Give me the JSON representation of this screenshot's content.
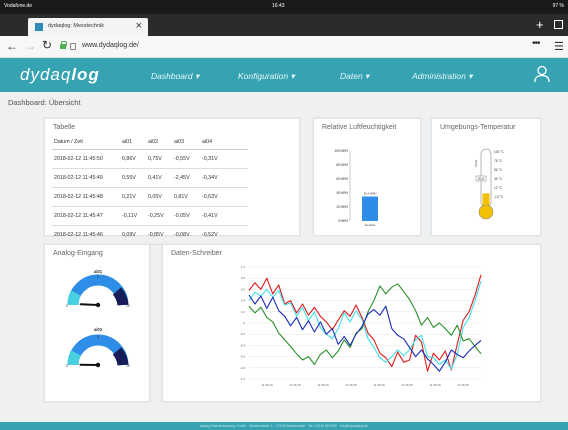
{
  "statusbar": {
    "carrier": "Vodafone.de",
    "time": "16:43",
    "battery": "97 %"
  },
  "browser": {
    "tab_title": "dydaqlog: Messtechnik",
    "url": "www.dydaqlog.de/",
    "more": "•••",
    "menu": "☰"
  },
  "nav": {
    "logo_light": "dydaq",
    "logo_bold": "log",
    "items": [
      {
        "label": "Dashboard ▾"
      },
      {
        "label": "Konfiguration ▾"
      },
      {
        "label": "Daten ▾"
      },
      {
        "label": "Administration ▾"
      }
    ]
  },
  "page": {
    "title": "Dashboard: Übersicht"
  },
  "tabelle": {
    "title": "Tabelle",
    "columns": [
      "Datum / Zeit",
      "ai01",
      "ai02",
      "ai03",
      "ai04"
    ],
    "rows": [
      [
        "2018-02-12  11:45:50",
        "0,86V",
        "0,75V",
        "-0,55V",
        "-0,31V"
      ],
      [
        "2018-02-12  11:45:49",
        "0,55V",
        "0,41V",
        "-2,45V",
        "-0,34V"
      ],
      [
        "2018-02-12  11:45:48",
        "0,21V",
        "0,05V",
        "0,81V",
        "-0,63V"
      ],
      [
        "2018-02-12  11:45:47",
        "-0,11V",
        "-0,25V",
        "-0,05V",
        "-0,41V"
      ],
      [
        "2018-02-12  11:45:46",
        "0,09V",
        "-0,85V",
        "-0,08V",
        "-0,52V"
      ]
    ]
  },
  "humidity": {
    "title": "Relative Luftfeuchtigkeit",
    "ticks": [
      "100%RH",
      "80%RH",
      "60%RH",
      "40%RH",
      "20%RH",
      "0%RH"
    ],
    "value": 35,
    "bar_label": "Feuchte",
    "value_text": "35,4 %RH",
    "color": "#2e8de6"
  },
  "temperature": {
    "title": "Umgebungs-Temperatur",
    "ticks": [
      "100 °C",
      "78 °C",
      "56 °C",
      "34 °C",
      "12 °C",
      "-10 °C"
    ],
    "value_text": "20,0",
    "label": "Temp",
    "level": 0.35,
    "color": "#f2c200"
  },
  "analog": {
    "title": "Analog-Eingang",
    "gauges": [
      {
        "label": "ai01",
        "value": 0.86,
        "min": "0",
        "max": "10",
        "mid": "5",
        "value_text": "0,86V"
      },
      {
        "label": "ai02",
        "value": 0.75,
        "min": "0",
        "max": "10",
        "mid": "5",
        "value_text": "0,75V"
      }
    ]
  },
  "recorder": {
    "title": "Daten-Schreiber",
    "colors": {
      "ai01": "#e01818",
      "ai02": "#3fe0e8",
      "ai03": "#2a8f2a",
      "ai04": "#1a2cb8"
    }
  },
  "footer": {
    "text": "dydaq Datenerfassung GmbH · Musterstraße 1 · 12345 Musterstadt · Tel. 01234 567890 · info@dydaqlog.de"
  },
  "chart_data": {
    "type": "line",
    "title": "Daten-Schreiber",
    "xlabel": "",
    "ylabel": "",
    "ylim": [
      -1,
      1
    ],
    "yticks": [
      "1.0",
      "0.8",
      "0.6",
      "0.4",
      "0.2",
      "0",
      "-0.2",
      "-0.4",
      "-0.6",
      "-0.8",
      "-1.0"
    ],
    "x": [
      "11:45:10",
      "11:45:15",
      "11:45:20",
      "11:45:25",
      "11:45:30",
      "11:45:35",
      "11:45:40",
      "11:45:45"
    ],
    "series": [
      {
        "name": "ai01",
        "values": [
          0.58,
          0.72,
          0.6,
          0.8,
          0.52,
          0.68,
          0.34,
          0.4,
          0.18,
          0.34,
          0.14,
          0.28,
          0.12,
          0.02,
          -0.12,
          0.05,
          0.22,
          0.12,
          0.32,
          0.1,
          -0.18,
          -0.3,
          -0.54,
          -0.62,
          -0.78,
          -0.52,
          -0.7,
          -0.66,
          -0.22,
          -0.34,
          -0.86,
          -0.54,
          -0.66,
          -0.5,
          -0.84,
          -0.38,
          0.05,
          0.2,
          0.5,
          0.86
        ]
      },
      {
        "name": "ai02",
        "values": [
          0.4,
          0.55,
          0.48,
          0.6,
          0.46,
          0.58,
          0.32,
          0.36,
          0.12,
          0.28,
          0.04,
          0.2,
          -0.08,
          -0.2,
          -0.28,
          -0.1,
          0.18,
          0.02,
          0.22,
          0.06,
          -0.28,
          -0.44,
          -0.62,
          -0.7,
          -0.6,
          -0.48,
          -0.58,
          -0.48,
          -0.3,
          -0.22,
          -0.6,
          -0.62,
          -0.74,
          -0.66,
          -0.82,
          -0.56,
          -0.08,
          0.1,
          0.4,
          0.75
        ]
      },
      {
        "name": "ai03",
        "values": [
          0.3,
          0.18,
          0.28,
          0.1,
          0.02,
          -0.18,
          -0.3,
          -0.42,
          -0.55,
          -0.66,
          -0.6,
          -0.74,
          -0.56,
          -0.48,
          -0.62,
          -0.5,
          -0.3,
          -0.44,
          -0.18,
          -0.1,
          0.2,
          0.4,
          0.66,
          0.52,
          0.64,
          0.7,
          0.56,
          0.42,
          0.22,
          -0.04,
          0.1,
          -0.08,
          0.0,
          -0.1,
          -0.22,
          -0.04,
          -0.32,
          -0.28,
          -0.42,
          -0.55
        ]
      },
      {
        "name": "ai04",
        "values": [
          0.5,
          0.34,
          0.48,
          0.26,
          0.46,
          0.22,
          0.12,
          -0.05,
          0.1,
          -0.12,
          0.04,
          -0.16,
          0.02,
          -0.2,
          -0.1,
          -0.38,
          -0.24,
          -0.4,
          -0.2,
          -0.06,
          0.16,
          0.24,
          0.14,
          0.3,
          -0.1,
          -0.22,
          -0.28,
          -0.44,
          -0.6,
          -0.48,
          -0.64,
          -0.74,
          -0.86,
          -0.7,
          -0.48,
          -0.56,
          -0.62,
          -0.5,
          -0.4,
          -0.31
        ]
      }
    ]
  }
}
